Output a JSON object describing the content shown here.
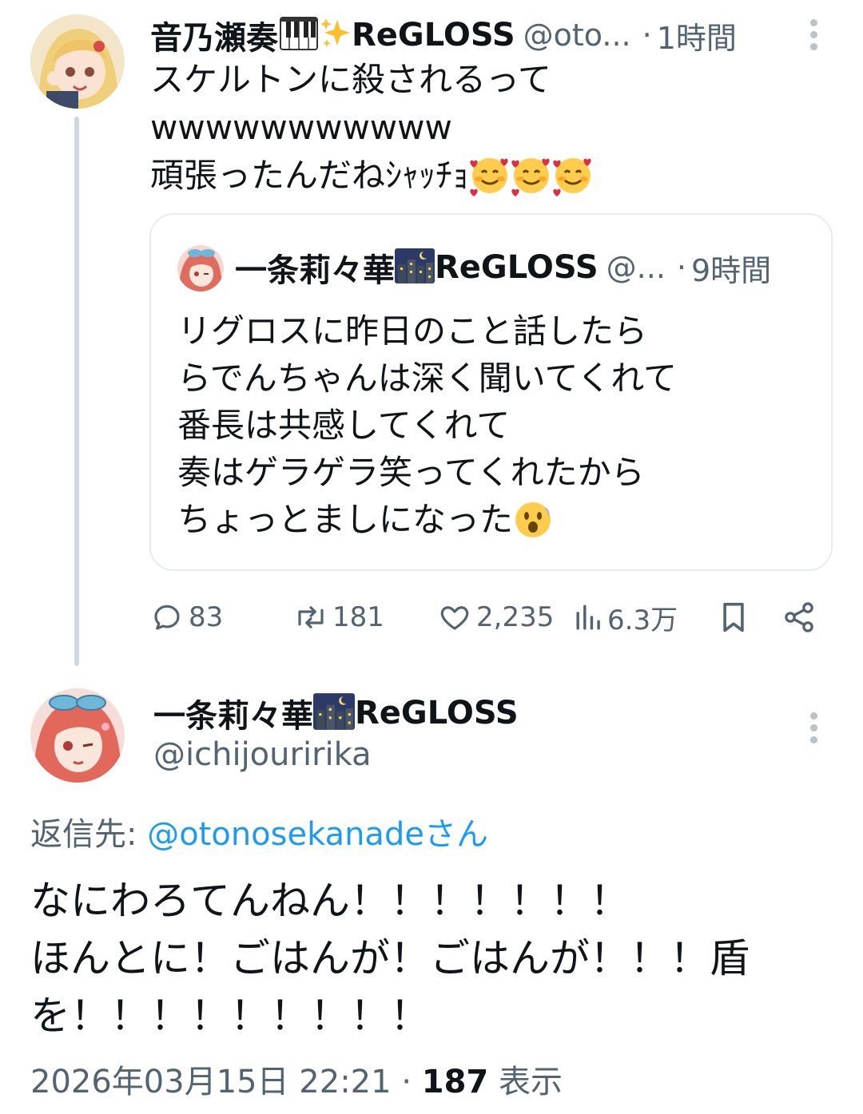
{
  "tweet1": {
    "display_name": "音乃瀬奏",
    "badges": [
      "piano-emoji",
      "sparkles-emoji"
    ],
    "group": "ReGLOSS",
    "handle": "@oto...",
    "separator": "·",
    "time": "1時間",
    "lines": [
      "スケルトンに殺されるって",
      "wwwwwwwwwww",
      "頑張ったんだねｼｬｯﾁｮ"
    ],
    "emoji_trailing": [
      "smiling-face-with-hearts",
      "smiling-face-with-hearts",
      "smiling-face-with-hearts"
    ]
  },
  "quote": {
    "display_name": "一条莉々華",
    "badge": "night-city-emoji",
    "group": "ReGLOSS",
    "handle": "@...",
    "separator": "·",
    "time": "9時間",
    "lines": [
      "リグロスに昨日のこと話したら",
      "らでんちゃんは深く聞いてくれて",
      "番長は共感してくれて",
      "奏はゲラゲラ笑ってくれたから",
      "ちょっとましになった"
    ],
    "emoji_trailing": "astonished-face"
  },
  "actions": {
    "replies": "83",
    "retweets": "181",
    "likes": "2,235",
    "views": "6.3万"
  },
  "tweet2": {
    "display_name": "一条莉々華",
    "badge": "night-city-emoji",
    "group": "ReGLOSS",
    "handle": "@ichijouririka",
    "reply_label": "返信先: ",
    "reply_target": "@otonosekanadeさん",
    "lines": [
      "なにわろてんねん！！！！！！！",
      "ほんとに！ごはんが！ごはんが！！！盾",
      "を！！！！！！！！！"
    ],
    "timestamp": "2026年03月15日 22:21",
    "separator": "·",
    "view_count": "187",
    "view_label": " 表示"
  },
  "colors": {
    "text": "#0f1419",
    "muted": "#536471",
    "link": "#1d9bf0",
    "border": "#e6ecf0",
    "thread_line": "#cfd9de"
  }
}
